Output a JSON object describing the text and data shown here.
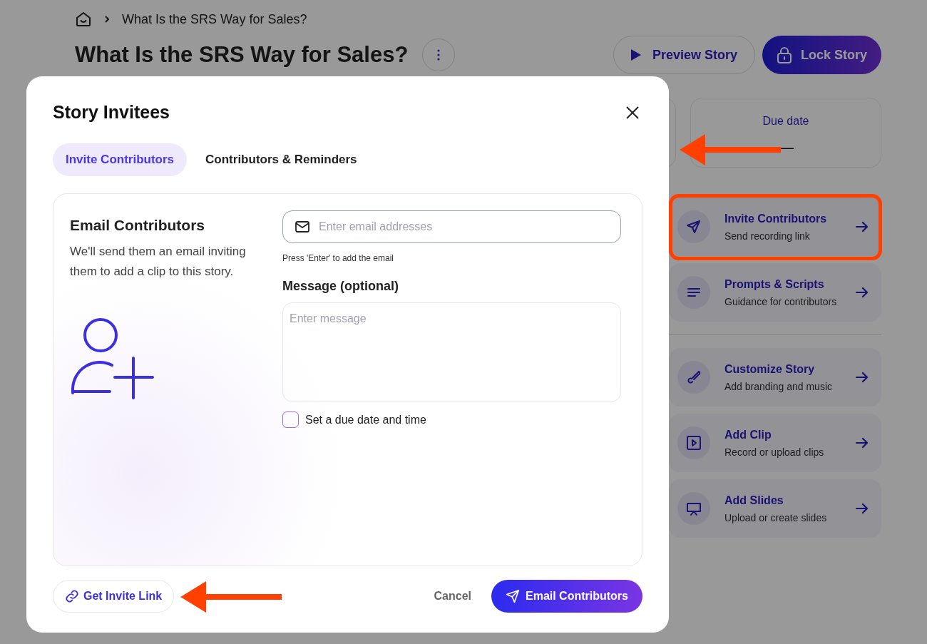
{
  "breadcrumb": {
    "current": "What Is the SRS Way for Sales?"
  },
  "page_title": "What Is the SRS Way for Sales?",
  "header_buttons": [
    {
      "label": "Preview Story",
      "kind": "outline"
    },
    {
      "label": "Lock Story",
      "kind": "primary"
    }
  ],
  "stats": [
    {
      "label": "Due date",
      "value": "—"
    }
  ],
  "actions": [
    {
      "title": "Invite Contributors",
      "subtitle": "Send recording link",
      "kind": "send"
    },
    {
      "title": "Prompts & Scripts",
      "subtitle": "Guidance for contributors",
      "kind": "lines"
    },
    {
      "kind": "divider"
    },
    {
      "title": "Customize Story",
      "subtitle": "Add branding and music",
      "kind": "brush"
    },
    {
      "title": "Add Clip",
      "subtitle": "Record or upload clips",
      "kind": "play"
    },
    {
      "title": "Add Slides",
      "subtitle": "Upload or create slides",
      "kind": "slides"
    }
  ],
  "modal": {
    "title": "Story Invitees",
    "tabs": [
      {
        "label": "Invite Contributors",
        "selected": true
      },
      {
        "label": "Contributors & Reminders",
        "selected": false
      }
    ],
    "section_title": "Email Contributors",
    "section_text": "We'll send them an email inviting them to add a clip to this story.",
    "email_field": {
      "placeholder": "Enter email addresses"
    },
    "email_hint": "Press 'Enter' to add the email",
    "message_label": "Message (optional)",
    "message_field": {
      "placeholder": "Enter message"
    },
    "due_date_checkbox": {
      "label": "Set a due date and time",
      "checked": false
    },
    "invite_link_button": "Get Invite Link",
    "cancel_button": "Cancel",
    "submit_button": "Email Contributors"
  },
  "annotations": [
    {
      "kind": "arrow"
    },
    {
      "kind": "outline"
    },
    {
      "kind": "arrow"
    }
  ]
}
